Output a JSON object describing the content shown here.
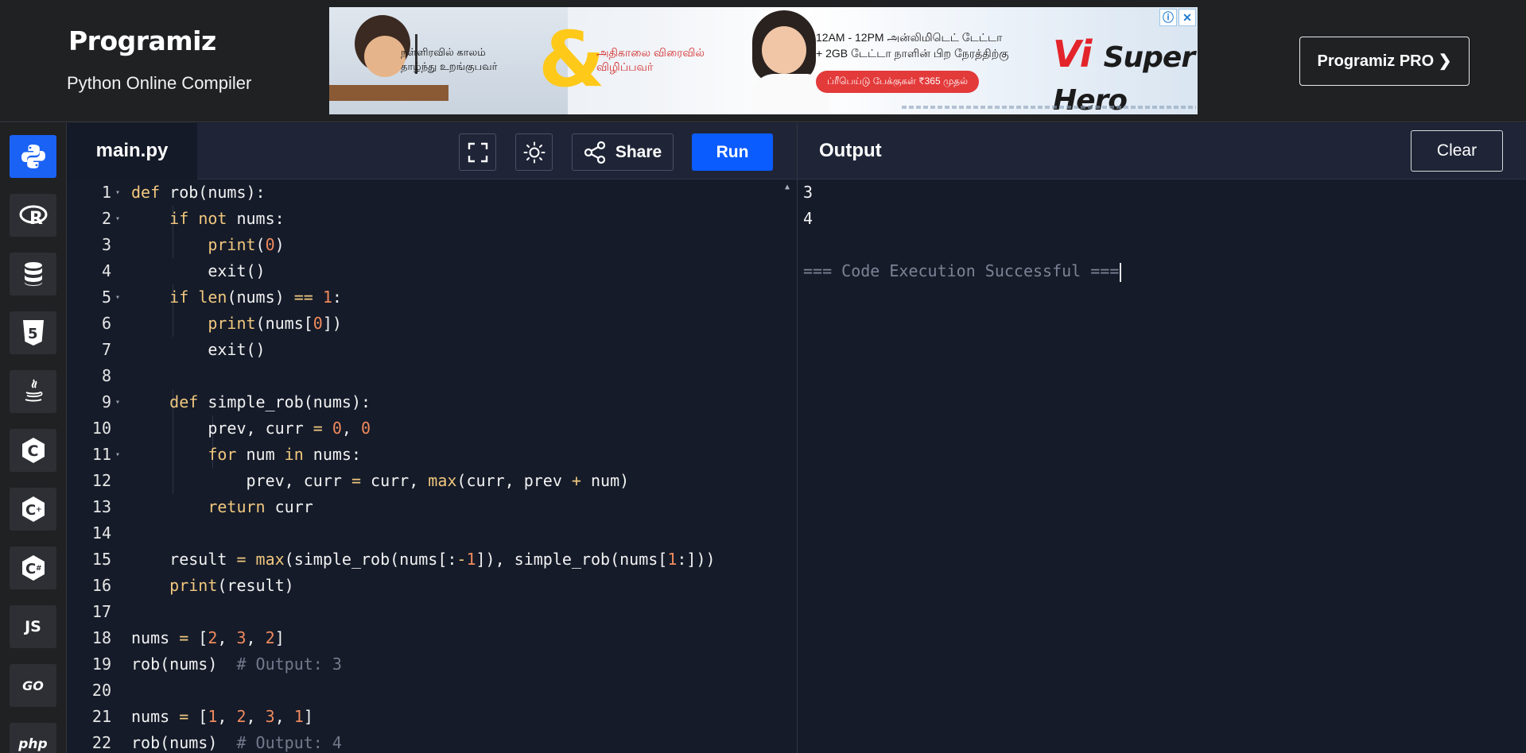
{
  "header": {
    "logo_text": "Programiz",
    "subtitle": "Python Online Compiler",
    "pro_button": "Programiz PRO ❯",
    "ad": {
      "left_text": "நள்ளிரவில் காலம் தாழ்ந்து உறங்குபவர்",
      "ampersand": "&",
      "middle_text": "அதிகாலை விரைவில் விழிப்பவர்",
      "right_text_line1": "12AM - 12PM அன்லிமிடெட் டேட்டா",
      "right_text_line2": "+ 2GB டேட்டா நாளின் பிற நேரத்திற்கு",
      "pill_text": "ப்ரீபெய்டு பேக்குகள் ₹365 முதல்",
      "brand": "Vi",
      "brand_sub": "Super Hero",
      "info_icon": "ⓘ",
      "close_icon": "✕"
    }
  },
  "languages": [
    {
      "name": "python",
      "label": "",
      "active": true
    },
    {
      "name": "r",
      "label": "R"
    },
    {
      "name": "sql",
      "label": ""
    },
    {
      "name": "html",
      "label": "5"
    },
    {
      "name": "java",
      "label": ""
    },
    {
      "name": "c",
      "label": "C"
    },
    {
      "name": "cpp",
      "label": "C+"
    },
    {
      "name": "csharp",
      "label": "C#"
    },
    {
      "name": "js",
      "label": "JS"
    },
    {
      "name": "go",
      "label": "GO"
    },
    {
      "name": "php",
      "label": "php"
    }
  ],
  "editor": {
    "tab_label": "main.py",
    "share_label": "Share",
    "run_label": "Run",
    "lines": [
      {
        "n": "1",
        "fold": true,
        "tokens": [
          [
            "kw",
            "def"
          ],
          [
            "txt",
            " rob(nums):"
          ]
        ]
      },
      {
        "n": "2",
        "fold": true,
        "tokens": [
          [
            "txt",
            "    "
          ],
          [
            "kw",
            "if"
          ],
          [
            "txt",
            " "
          ],
          [
            "kw",
            "not"
          ],
          [
            "txt",
            " nums:"
          ]
        ]
      },
      {
        "n": "3",
        "tokens": [
          [
            "txt",
            "        "
          ],
          [
            "fn",
            "print"
          ],
          [
            "txt",
            "("
          ],
          [
            "num",
            "0"
          ],
          [
            "txt",
            ")"
          ]
        ]
      },
      {
        "n": "4",
        "tokens": [
          [
            "txt",
            "        exit()"
          ]
        ]
      },
      {
        "n": "5",
        "fold": true,
        "tokens": [
          [
            "txt",
            "    "
          ],
          [
            "kw",
            "if"
          ],
          [
            "txt",
            " "
          ],
          [
            "fn",
            "len"
          ],
          [
            "txt",
            "(nums) "
          ],
          [
            "op",
            "=="
          ],
          [
            "txt",
            " "
          ],
          [
            "num",
            "1"
          ],
          [
            "txt",
            ":"
          ]
        ]
      },
      {
        "n": "6",
        "tokens": [
          [
            "txt",
            "        "
          ],
          [
            "fn",
            "print"
          ],
          [
            "txt",
            "(nums["
          ],
          [
            "num",
            "0"
          ],
          [
            "txt",
            "])"
          ]
        ]
      },
      {
        "n": "7",
        "tokens": [
          [
            "txt",
            "        exit()"
          ]
        ]
      },
      {
        "n": "8",
        "tokens": []
      },
      {
        "n": "9",
        "fold": true,
        "tokens": [
          [
            "txt",
            "    "
          ],
          [
            "kw",
            "def"
          ],
          [
            "txt",
            " simple_rob(nums):"
          ]
        ]
      },
      {
        "n": "10",
        "tokens": [
          [
            "txt",
            "        prev, curr "
          ],
          [
            "op",
            "="
          ],
          [
            "txt",
            " "
          ],
          [
            "num",
            "0"
          ],
          [
            "txt",
            ", "
          ],
          [
            "num",
            "0"
          ]
        ]
      },
      {
        "n": "11",
        "fold": true,
        "tokens": [
          [
            "txt",
            "        "
          ],
          [
            "kw",
            "for"
          ],
          [
            "txt",
            " num "
          ],
          [
            "kw",
            "in"
          ],
          [
            "txt",
            " nums:"
          ]
        ]
      },
      {
        "n": "12",
        "tokens": [
          [
            "txt",
            "            prev, curr "
          ],
          [
            "op",
            "="
          ],
          [
            "txt",
            " curr, "
          ],
          [
            "fn",
            "max"
          ],
          [
            "txt",
            "(curr, prev "
          ],
          [
            "op",
            "+"
          ],
          [
            "txt",
            " num)"
          ]
        ]
      },
      {
        "n": "13",
        "tokens": [
          [
            "txt",
            "        "
          ],
          [
            "kw",
            "return"
          ],
          [
            "txt",
            " curr"
          ]
        ]
      },
      {
        "n": "14",
        "tokens": []
      },
      {
        "n": "15",
        "tokens": [
          [
            "txt",
            "    result "
          ],
          [
            "op",
            "="
          ],
          [
            "txt",
            " "
          ],
          [
            "fn",
            "max"
          ],
          [
            "txt",
            "(simple_rob(nums[:"
          ],
          [
            "op",
            "-"
          ],
          [
            "num",
            "1"
          ],
          [
            "txt",
            "]), simple_rob(nums["
          ],
          [
            "num",
            "1"
          ],
          [
            "txt",
            ":]))"
          ]
        ]
      },
      {
        "n": "16",
        "tokens": [
          [
            "txt",
            "    "
          ],
          [
            "fn",
            "print"
          ],
          [
            "txt",
            "(result)"
          ]
        ]
      },
      {
        "n": "17",
        "tokens": []
      },
      {
        "n": "18",
        "tokens": [
          [
            "txt",
            "nums "
          ],
          [
            "op",
            "="
          ],
          [
            "txt",
            " ["
          ],
          [
            "num",
            "2"
          ],
          [
            "txt",
            ", "
          ],
          [
            "num",
            "3"
          ],
          [
            "txt",
            ", "
          ],
          [
            "num",
            "2"
          ],
          [
            "txt",
            "]"
          ]
        ]
      },
      {
        "n": "19",
        "tokens": [
          [
            "txt",
            "rob(nums)  "
          ],
          [
            "cm",
            "# Output: 3"
          ]
        ]
      },
      {
        "n": "20",
        "tokens": []
      },
      {
        "n": "21",
        "tokens": [
          [
            "txt",
            "nums "
          ],
          [
            "op",
            "="
          ],
          [
            "txt",
            " ["
          ],
          [
            "num",
            "1"
          ],
          [
            "txt",
            ", "
          ],
          [
            "num",
            "2"
          ],
          [
            "txt",
            ", "
          ],
          [
            "num",
            "3"
          ],
          [
            "txt",
            ", "
          ],
          [
            "num",
            "1"
          ],
          [
            "txt",
            "]"
          ]
        ]
      },
      {
        "n": "22",
        "tokens": [
          [
            "txt",
            "rob(nums)  "
          ],
          [
            "cm",
            "# Output: 4"
          ]
        ]
      }
    ]
  },
  "output": {
    "title": "Output",
    "clear_label": "Clear",
    "lines": [
      "3",
      "4",
      "",
      "=== Code Execution Successful ==="
    ]
  },
  "colors": {
    "run_button": "#0b5cff",
    "active_language": "#1a62f4",
    "keyword": "#f1c87e",
    "number": "#f08a5d",
    "comment": "#727a8c"
  }
}
